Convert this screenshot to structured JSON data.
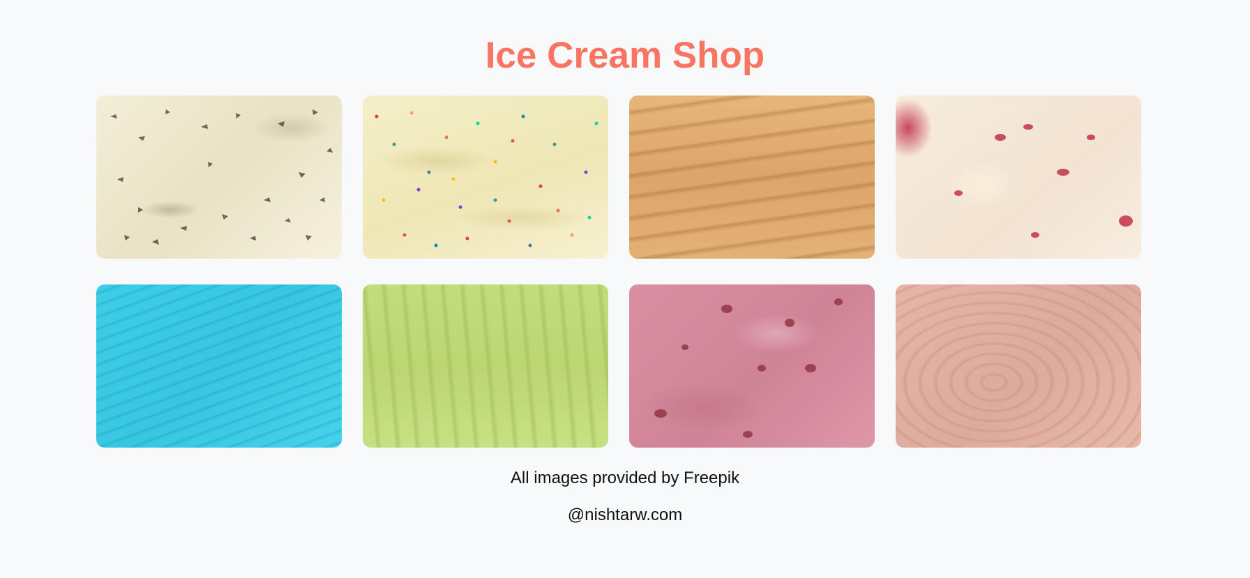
{
  "header": {
    "title": "Ice Cream Shop",
    "title_color": "#fa7462"
  },
  "gallery": {
    "items": [
      {
        "name": "Cookies & cream ice cream texture",
        "base_color": "#f0ead0"
      },
      {
        "name": "Vanilla ice cream with rainbow sprinkles",
        "base_color": "#f2ebbf"
      },
      {
        "name": "Caramel ice cream texture",
        "base_color": "#e1ac70"
      },
      {
        "name": "Cherry vanilla ice cream texture",
        "base_color": "#f5e8d8"
      },
      {
        "name": "Blue ice cream texture",
        "base_color": "#3ecbe4"
      },
      {
        "name": "Pistachio green ice cream texture",
        "base_color": "#c0da7a"
      },
      {
        "name": "Raspberry ripple ice cream texture",
        "base_color": "#d68c9f"
      },
      {
        "name": "Strawberry pink ice cream texture",
        "base_color": "#e2b1a2"
      }
    ]
  },
  "footer": {
    "credit": "All images provided by Freepik",
    "handle": "@nishtarw.com"
  }
}
